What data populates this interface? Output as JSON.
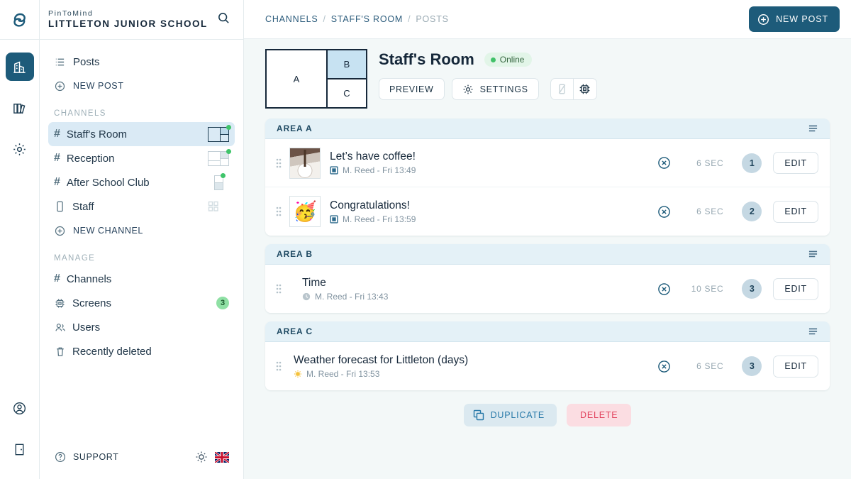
{
  "brand": {
    "product": "PinToMind",
    "org": "LITTLETON JUNIOR SCHOOL",
    "search_icon": "search-icon"
  },
  "rail": {
    "logo_icon": "pintomind-logo-icon",
    "items": [
      {
        "icon": "building-icon",
        "name": "organisation",
        "active": true
      },
      {
        "icon": "books-icon",
        "name": "library",
        "active": false
      },
      {
        "icon": "gear-icon",
        "name": "settings",
        "active": false
      }
    ],
    "bottom": [
      {
        "icon": "user-circle-icon",
        "name": "account"
      },
      {
        "icon": "logout-door-icon",
        "name": "logout"
      }
    ]
  },
  "sidebar": {
    "top_links": [
      {
        "label": "Posts",
        "icon": "list-icon"
      },
      {
        "label": "NEW POST",
        "icon": "plus-circle-icon"
      }
    ],
    "channels_header": "CHANNELS",
    "channels": [
      {
        "label": "Staff's Room",
        "icon": "hash-icon",
        "selected": true,
        "layout": "split-right",
        "online": true
      },
      {
        "label": "Reception",
        "icon": "hash-icon",
        "selected": false,
        "layout": "split-right",
        "online": true
      },
      {
        "label": "After School Club",
        "icon": "hash-icon",
        "selected": false,
        "layout": "stacked",
        "online": true
      },
      {
        "label": "Staff",
        "icon": "mobile-icon",
        "selected": false,
        "layout": "grid",
        "online": false
      }
    ],
    "new_channel": {
      "label": "NEW CHANNEL",
      "icon": "plus-circle-icon"
    },
    "manage_header": "MANAGE",
    "manage": [
      {
        "label": "Channels",
        "icon": "hash-icon",
        "badge": ""
      },
      {
        "label": "Screens",
        "icon": "chip-icon",
        "badge": "3"
      },
      {
        "label": "Users",
        "icon": "users-icon",
        "badge": ""
      },
      {
        "label": "Recently deleted",
        "icon": "trash-icon",
        "badge": ""
      }
    ],
    "footer": {
      "support_label": "SUPPORT",
      "support_icon": "question-circle-icon",
      "theme_icon": "sun-icon",
      "language_icon": "uk-flag-icon"
    }
  },
  "topbar": {
    "breadcrumb": [
      "CHANNELS",
      "STAFF'S ROOM",
      "POSTS"
    ],
    "separator": "/",
    "new_post": {
      "label": "NEW POST",
      "icon": "plus-circle-icon"
    }
  },
  "channel": {
    "title": "Staff's Room",
    "status": {
      "label": "Online",
      "color": "#41c169"
    },
    "layout_preview": {
      "zones": [
        "A",
        "B",
        "C"
      ],
      "active_zone": "B"
    },
    "actions": [
      {
        "label": "PREVIEW",
        "icon": ""
      },
      {
        "label": "SETTINGS",
        "icon": "gear-icon"
      }
    ],
    "icon_buttons": [
      {
        "icon": "mobile-disabled-icon",
        "name": "mobile-view-button"
      },
      {
        "icon": "chip-icon",
        "name": "screen-view-button"
      }
    ]
  },
  "areas": [
    {
      "name": "AREA A",
      "sort_icon": "sort-list-icon",
      "posts": [
        {
          "title": "Let’s have coffee!",
          "author": "M. Reed",
          "timestamp": "Fri 13:49",
          "meta": "M. Reed - Fri 13:49",
          "type_icon": "image-icon",
          "duration": "6 SEC",
          "order": "1",
          "thumb": "coffee-photo",
          "delete_icon": "x-circle-icon",
          "edit_label": "EDIT"
        },
        {
          "title": "Congratulations!",
          "author": "M. Reed",
          "timestamp": "Fri 13:59",
          "meta": "M. Reed - Fri 13:59",
          "type_icon": "image-icon",
          "duration": "6 SEC",
          "order": "2",
          "thumb": "🥳",
          "delete_icon": "x-circle-icon",
          "edit_label": "EDIT"
        }
      ]
    },
    {
      "name": "AREA B",
      "sort_icon": "sort-list-icon",
      "posts": [
        {
          "title": "Time",
          "author": "M. Reed",
          "timestamp": "Fri 13:43",
          "meta": "M. Reed - Fri 13:43",
          "type_icon": "clock-icon",
          "duration": "10 SEC",
          "order": "3",
          "thumb": "",
          "delete_icon": "x-circle-icon",
          "edit_label": "EDIT"
        }
      ]
    },
    {
      "name": "AREA C",
      "sort_icon": "sort-list-icon",
      "posts": [
        {
          "title": "Weather forecast for Littleton (days)",
          "author": "M. Reed",
          "timestamp": "Fri 13:53",
          "meta": "M. Reed - Fri 13:53",
          "type_icon": "sun-icon",
          "duration": "6 SEC",
          "order": "3",
          "thumb": "",
          "delete_icon": "x-circle-icon",
          "edit_label": "EDIT"
        }
      ]
    }
  ],
  "footer_actions": {
    "duplicate": {
      "label": "DUPLICATE",
      "icon": "copy-icon"
    },
    "delete": {
      "label": "DELETE"
    }
  },
  "colors": {
    "brand_navy": "#1d5b7a",
    "selected_blue": "#daeaf5",
    "area_header": "#e4f1f7",
    "page_bg": "#f3f8f8",
    "online_green": "#41c169",
    "delete_red": "#e1435d"
  }
}
